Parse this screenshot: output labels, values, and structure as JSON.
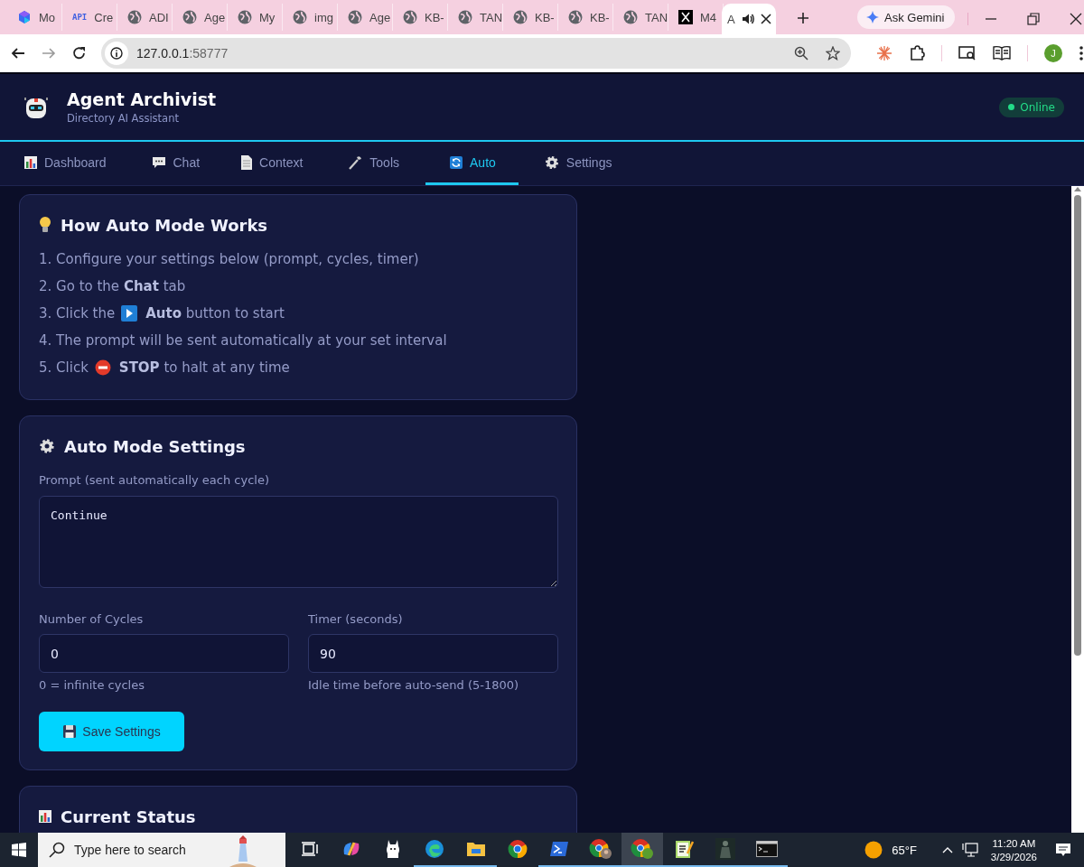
{
  "browser": {
    "tabs": [
      {
        "title": "Mo",
        "kind": "logo",
        "selected": false
      },
      {
        "title": "Cre",
        "kind": "api",
        "icon_text": "API",
        "selected": false
      },
      {
        "title": "ADI",
        "kind": "globe",
        "selected": false
      },
      {
        "title": "Age",
        "kind": "globe",
        "selected": false
      },
      {
        "title": "My",
        "kind": "globe",
        "selected": false
      },
      {
        "title": "img",
        "kind": "globe",
        "selected": false
      },
      {
        "title": "Age",
        "kind": "globe",
        "selected": false
      },
      {
        "title": "KB-",
        "kind": "globe",
        "selected": false
      },
      {
        "title": "TAN",
        "kind": "globe",
        "selected": false
      },
      {
        "title": "KB-",
        "kind": "globe",
        "selected": false
      },
      {
        "title": "KB-",
        "kind": "globe",
        "selected": false
      },
      {
        "title": "TAN",
        "kind": "globe",
        "selected": false
      },
      {
        "title": "M4",
        "kind": "x",
        "selected": false
      },
      {
        "title": "A",
        "kind": "blank",
        "selected": true,
        "audio": true
      }
    ],
    "ask_button": "Ask Gemini",
    "address": {
      "host": "127.0.0.1",
      "port": ":58777"
    },
    "avatar": "J"
  },
  "app": {
    "title": "Agent Archivist",
    "subtitle": "Directory AI Assistant",
    "status": "Online",
    "online": true,
    "nav": [
      {
        "label": "Dashboard",
        "kind": "chart",
        "selected": false
      },
      {
        "label": "Chat",
        "kind": "bubble",
        "selected": false
      },
      {
        "label": "Context",
        "kind": "document",
        "selected": false
      },
      {
        "label": "Tools",
        "kind": "wrench",
        "selected": false
      },
      {
        "label": "Auto",
        "kind": "refresh",
        "selected": true
      },
      {
        "label": "Settings",
        "kind": "gear",
        "selected": false
      }
    ],
    "how_card": {
      "title": "How Auto Mode Works",
      "steps": [
        {
          "text": "1. Configure your settings below (prompt, cycles, timer)"
        },
        {
          "text": "2. Go to the **Chat** tab"
        },
        {
          "text": "3. Click the",
          "kind": "play",
          "text_after": "**Auto** button to start"
        },
        {
          "text": "4. The prompt will be sent automatically at your set interval"
        },
        {
          "text": "5. Click",
          "kind": "stop",
          "text_after": "**STOP** to halt at any time"
        }
      ]
    },
    "settings_card": {
      "title": "Auto Mode Settings",
      "prompt_label": "Prompt (sent automatically each cycle)",
      "prompt_value": "Continue",
      "fields": [
        {
          "label": "Number of Cycles",
          "value": "0",
          "hint": "0 = infinite cycles"
        },
        {
          "label": "Timer (seconds)",
          "value": "90",
          "hint": "Idle time before auto-send (5-1800)"
        }
      ],
      "save_button": "Save Settings"
    },
    "status_card": {
      "title": "Current Status"
    }
  },
  "taskbar": {
    "search_placeholder": "Type here to search",
    "apps": [
      {
        "kind": "taskview",
        "running": false,
        "selected": false
      },
      {
        "kind": "copilot",
        "running": false,
        "selected": false
      },
      {
        "kind": "llama",
        "running": false,
        "selected": false
      },
      {
        "kind": "edge",
        "running": true,
        "selected": false
      },
      {
        "kind": "folder",
        "running": true,
        "selected": false
      },
      {
        "kind": "chrome",
        "running": false,
        "selected": false
      },
      {
        "kind": "powershell",
        "running": true,
        "selected": false
      },
      {
        "kind": "chrome-profile",
        "running": true,
        "selected": false
      },
      {
        "kind": "chrome-j",
        "running": true,
        "selected": true
      },
      {
        "kind": "notepad",
        "running": true,
        "selected": false
      },
      {
        "kind": "figure",
        "running": true,
        "selected": false
      },
      {
        "kind": "terminal",
        "running": true,
        "selected": false
      }
    ],
    "weather": "65°F",
    "time": "11:20 AM",
    "date": "3/29/2026"
  }
}
